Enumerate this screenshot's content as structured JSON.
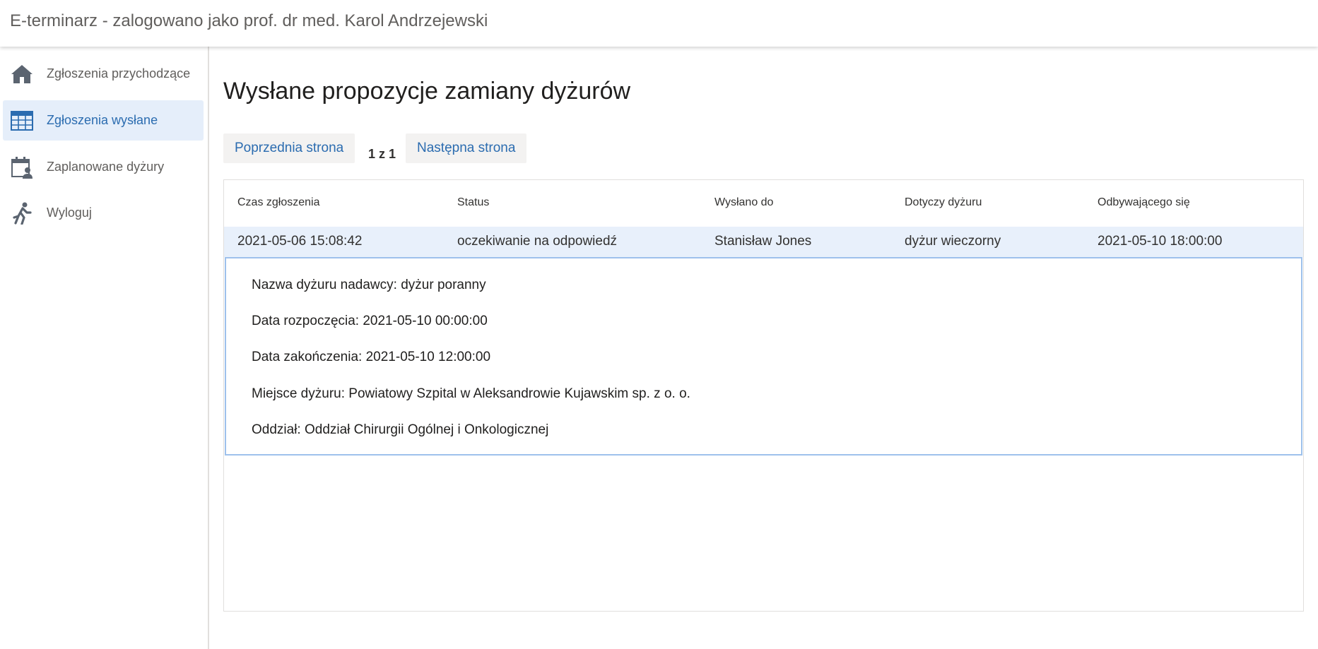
{
  "header": {
    "title": "E-terminarz - zalogowano jako prof. dr med. Karol Andrzejewski"
  },
  "sidebar": {
    "items": [
      {
        "label": "Zgłoszenia przychodzące",
        "icon": "home-icon"
      },
      {
        "label": "Zgłoszenia wysłane",
        "icon": "table-icon",
        "active": true
      },
      {
        "label": "Zaplanowane dyżury",
        "icon": "calendar-person-icon"
      },
      {
        "label": "Wyloguj",
        "icon": "running-person-icon"
      }
    ]
  },
  "main": {
    "title": "Wysłane propozycje zamiany dyżurów",
    "pager": {
      "prev_label": "Poprzednia strona",
      "page_indicator": "1 z 1",
      "next_label": "Następna strona"
    },
    "table": {
      "columns": [
        "Czas zgłoszenia",
        "Status",
        "Wysłano do",
        "Dotyczy dyżuru",
        "Odbywającego się"
      ],
      "rows": [
        [
          "2021-05-06 15:08:42",
          "oczekiwanie na odpowiedź",
          "Stanisław Jones",
          "dyżur wieczorny",
          "2021-05-10 18:00:00"
        ]
      ],
      "details": [
        "Nazwa dyżuru nadawcy: dyżur poranny",
        "Data rozpoczęcia: 2021-05-10 00:00:00",
        "Data zakończenia: 2021-05-10 12:00:00",
        "Miejsce dyżuru: Powiatowy Szpital w Aleksandrowie Kujawskim sp. z o. o.",
        "Oddział: Oddział Chirurgii Ogólnej i Onkologicznej"
      ]
    }
  },
  "colors": {
    "accent": "#2b6cb0",
    "active_bg": "#e5eefa",
    "row_highlight": "#e8f0fb",
    "details_border": "#9ec1ec"
  }
}
